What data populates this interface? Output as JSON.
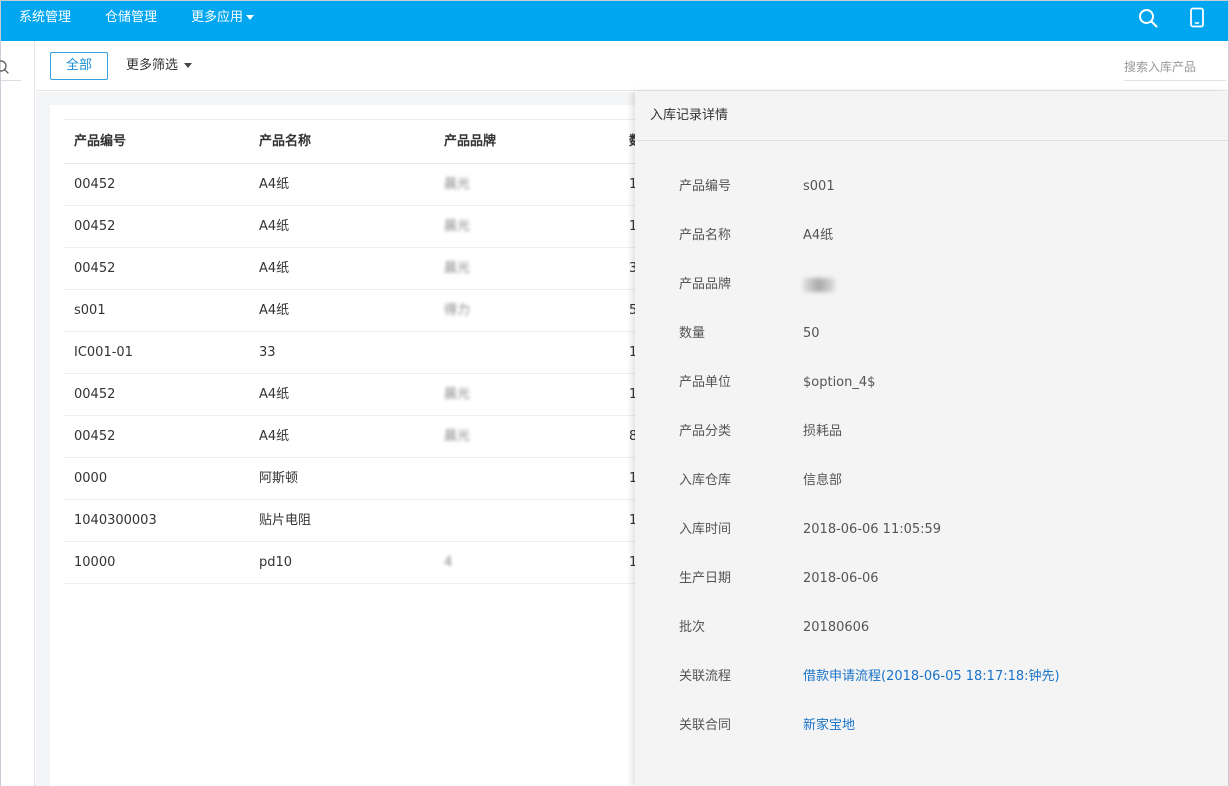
{
  "nav": {
    "items": [
      "系统管理",
      "仓储管理",
      "更多应用"
    ]
  },
  "toolbar": {
    "all_label": "全部",
    "filter_label": "更多筛选",
    "search_placeholder": "搜索入库产品"
  },
  "table": {
    "headers": [
      "产品编号",
      "产品名称",
      "产品品牌",
      "数"
    ],
    "rows": [
      {
        "code": "00452",
        "name": "A4纸",
        "brand": "晨光",
        "qty": "1"
      },
      {
        "code": "00452",
        "name": "A4纸",
        "brand": "晨光",
        "qty": "1"
      },
      {
        "code": "00452",
        "name": "A4纸",
        "brand": "晨光",
        "qty": "3"
      },
      {
        "code": "s001",
        "name": "A4纸",
        "brand": "得力",
        "qty": "5"
      },
      {
        "code": "IC001-01",
        "name": "33",
        "brand": "",
        "qty": "1"
      },
      {
        "code": "00452",
        "name": "A4纸",
        "brand": "晨光",
        "qty": "1"
      },
      {
        "code": "00452",
        "name": "A4纸",
        "brand": "晨光",
        "qty": "8"
      },
      {
        "code": "0000",
        "name": "阿斯顿",
        "brand": "",
        "qty": "1"
      },
      {
        "code": "1040300003",
        "name": "贴片电阻",
        "brand": "",
        "qty": "1"
      },
      {
        "code": "10000",
        "name": "pd10",
        "brand": "4",
        "qty": "1"
      }
    ]
  },
  "detail": {
    "title": "入库记录详情",
    "fields": [
      {
        "label": "产品编号",
        "value": "s001"
      },
      {
        "label": "产品名称",
        "value": "A4纸"
      },
      {
        "label": "产品品牌",
        "value": ""
      },
      {
        "label": "数量",
        "value": "50"
      },
      {
        "label": "产品单位",
        "value": "$option_4$"
      },
      {
        "label": "产品分类",
        "value": "损耗品"
      },
      {
        "label": "入库仓库",
        "value": "信息部"
      },
      {
        "label": "入库时间",
        "value": "2018-06-06 11:05:59"
      },
      {
        "label": "生产日期",
        "value": "2018-06-06"
      },
      {
        "label": "批次",
        "value": "20180606"
      },
      {
        "label": "关联流程",
        "value": "借款申请流程(2018-06-05 18:17:18:钟先)"
      },
      {
        "label": "关联合同",
        "value": "新家宝地"
      }
    ]
  },
  "colors": {
    "topbar": "#00a6f0",
    "link": "#1a73c9",
    "accent_button": "#30a2e0"
  }
}
